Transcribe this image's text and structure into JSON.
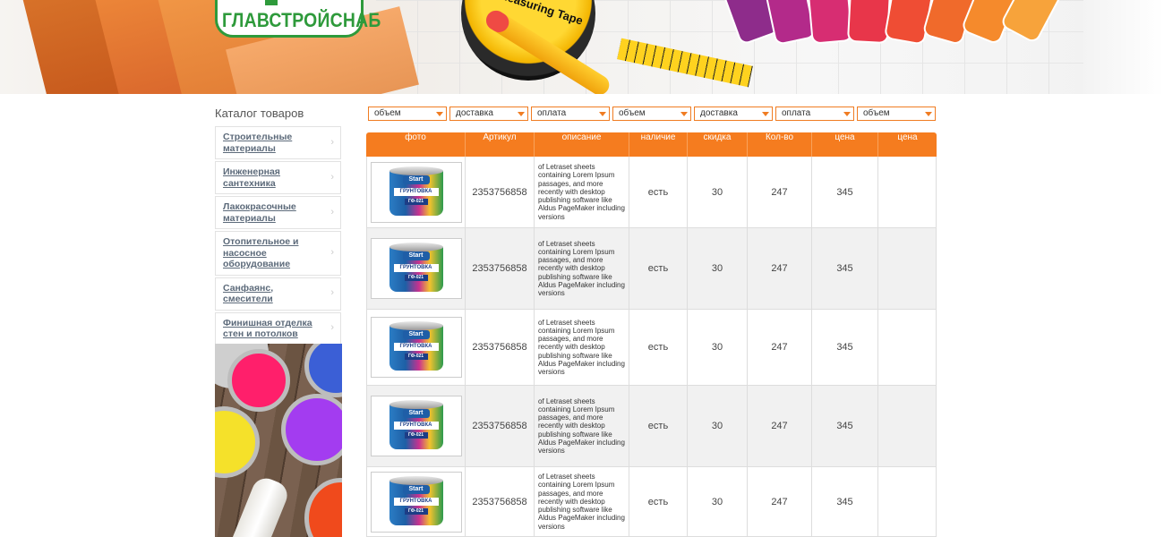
{
  "header": {
    "logo_text": "ГЛАВСТРОЙСНАБ",
    "tape_label": "Measuring Tape"
  },
  "catalog": {
    "title": "Каталог товаров",
    "items": [
      {
        "label": "Строительные материалы"
      },
      {
        "label": "Инженерная сантехника"
      },
      {
        "label": "Лакокрасочные материалы"
      },
      {
        "label": "Отопительное и насосное оборудование"
      },
      {
        "label": "Санфаянс, смесители"
      },
      {
        "label": "Финишная отделка стен и потолков"
      }
    ]
  },
  "filters": [
    "объем",
    "доставка",
    "оплата",
    "объем",
    "доставка",
    "оплата",
    "объем"
  ],
  "table": {
    "headers": [
      "фото",
      "Артикул",
      "описание",
      "наличие",
      "скидка",
      "Кол-во",
      "цена",
      "цена"
    ],
    "product": {
      "brand": "Start",
      "name": "ГРУНТОВКА",
      "code": "ГФ-021"
    },
    "rows": [
      {
        "article": "2353756858",
        "description": "of Letraset sheets containing Lorem Ipsum passages, and more recently with desktop publishing software like Aldus PageMaker including versions",
        "stock": "есть",
        "discount": "30",
        "qty": "247",
        "price": "345",
        "price2": ""
      },
      {
        "article": "2353756858",
        "description": "of Letraset sheets containing Lorem Ipsum passages, and more recently with desktop publishing software like Aldus PageMaker including versions",
        "stock": "есть",
        "discount": "30",
        "qty": "247",
        "price": "345",
        "price2": ""
      },
      {
        "article": "2353756858",
        "description": "of Letraset sheets containing Lorem Ipsum passages, and more recently with desktop publishing software like Aldus PageMaker including versions",
        "stock": "есть",
        "discount": "30",
        "qty": "247",
        "price": "345",
        "price2": ""
      },
      {
        "article": "2353756858",
        "description": "of Letraset sheets containing Lorem Ipsum passages, and more recently with desktop publishing software like Aldus PageMaker including versions",
        "stock": "есть",
        "discount": "30",
        "qty": "247",
        "price": "345",
        "price2": ""
      },
      {
        "article": "2353756858",
        "description": "of Letraset sheets containing Lorem Ipsum passages, and more recently with desktop publishing software like Aldus PageMaker including versions",
        "stock": "есть",
        "discount": "30",
        "qty": "247",
        "price": "345",
        "price2": ""
      }
    ]
  },
  "colors": {
    "accent": "#f57c1f",
    "logo_green": "#2e9a3b",
    "link": "#5c6a7a"
  }
}
